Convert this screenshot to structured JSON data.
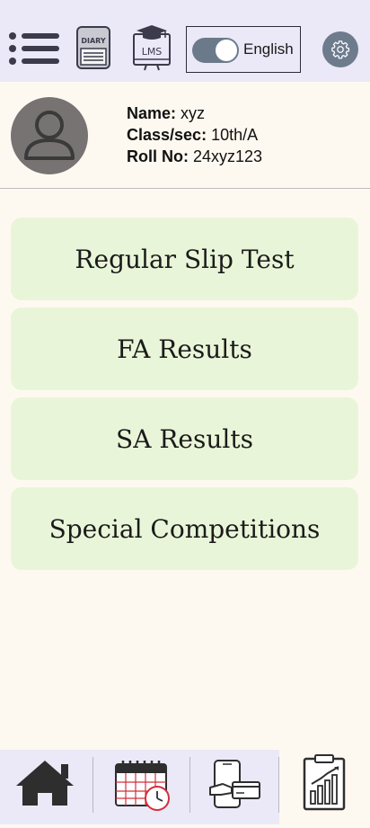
{
  "header": {
    "menu_icon": "hamburger-menu-icon",
    "diary_label": "DIARY",
    "lms_label": "LMS",
    "language": "English",
    "settings_icon": "gear-icon"
  },
  "profile": {
    "name_label": "Name:",
    "name_value": "xyz",
    "class_label": "Class/sec:",
    "class_value": "10th/A",
    "roll_label": "Roll No:",
    "roll_value": "24xyz123"
  },
  "menu": {
    "items": [
      {
        "label": "Regular Slip Test"
      },
      {
        "label": "FA Results"
      },
      {
        "label": "SA Results"
      },
      {
        "label": "Special Competitions"
      }
    ]
  },
  "bottom_nav": {
    "items": [
      {
        "icon": "home-icon"
      },
      {
        "icon": "calendar-clock-icon"
      },
      {
        "icon": "mobile-payment-icon"
      },
      {
        "icon": "report-chart-icon",
        "active": true
      }
    ]
  },
  "colors": {
    "header_bg": "#ebe8f7",
    "page_bg": "#fef9f0",
    "card_bg": "#e9f5d8",
    "calendar_accent": "#d1303c"
  }
}
